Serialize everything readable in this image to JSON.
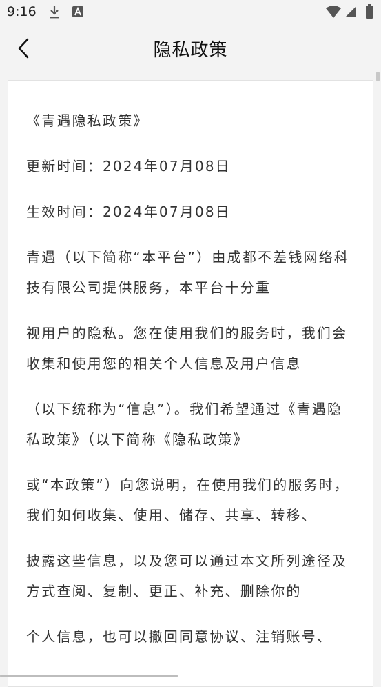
{
  "status_bar": {
    "time": "9:16",
    "icons": [
      "download-icon",
      "a-notification-icon",
      "wifi-icon",
      "signal-icon",
      "battery-icon"
    ]
  },
  "header": {
    "title": "隐私政策",
    "back_icon": "chevron-left-icon"
  },
  "document": {
    "title": "《青遇隐私政策》",
    "updated": "更新时间：2024年07月08日",
    "effective": "生效时间：2024年07月08日",
    "paragraphs": [
      "青遇（以下简称“本平台”）由成都不差钱网络科技有限公司提供服务，本平台十分重",
      "视用户的隐私。您在使用我们的服务时，我们会收集和使用您的相关个人信息及用户信息",
      "（以下统称为“信息”）。我们希望通过《青遇隐私政策》（以下简称《隐私政策》",
      "或“本政策”）向您说明，在使用我们的服务时，我们如何收集、使用、储存、共享、转移、",
      "披露这些信息，以及您可以通过本文所列途径及方式查阅、复制、更正、补充、删除你的",
      "个人信息，也可以撤回同意协议、注销账号、"
    ]
  }
}
